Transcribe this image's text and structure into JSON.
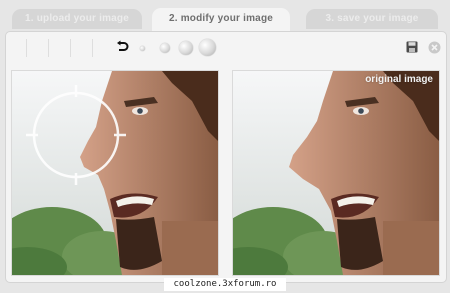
{
  "steps": {
    "step1": "1. upload your image",
    "step2": "2. modify your image",
    "step3": "3. save your image",
    "active": "step2"
  },
  "toolbar": {
    "icons": [
      "undo-icon",
      "brush-size-xs-icon",
      "brush-size-s-icon",
      "brush-size-m-icon",
      "brush-size-l-icon",
      "save-icon",
      "close-icon"
    ]
  },
  "preview": {
    "original_label": "original image"
  },
  "footer": {
    "watermark": "coolzone.3xforum.ro"
  },
  "colors": {
    "background": "#e6e6e6",
    "panel": "#f4f4f4",
    "tab_active_text": "#6f6f6f",
    "tab_inactive": "#d6d6d6"
  }
}
